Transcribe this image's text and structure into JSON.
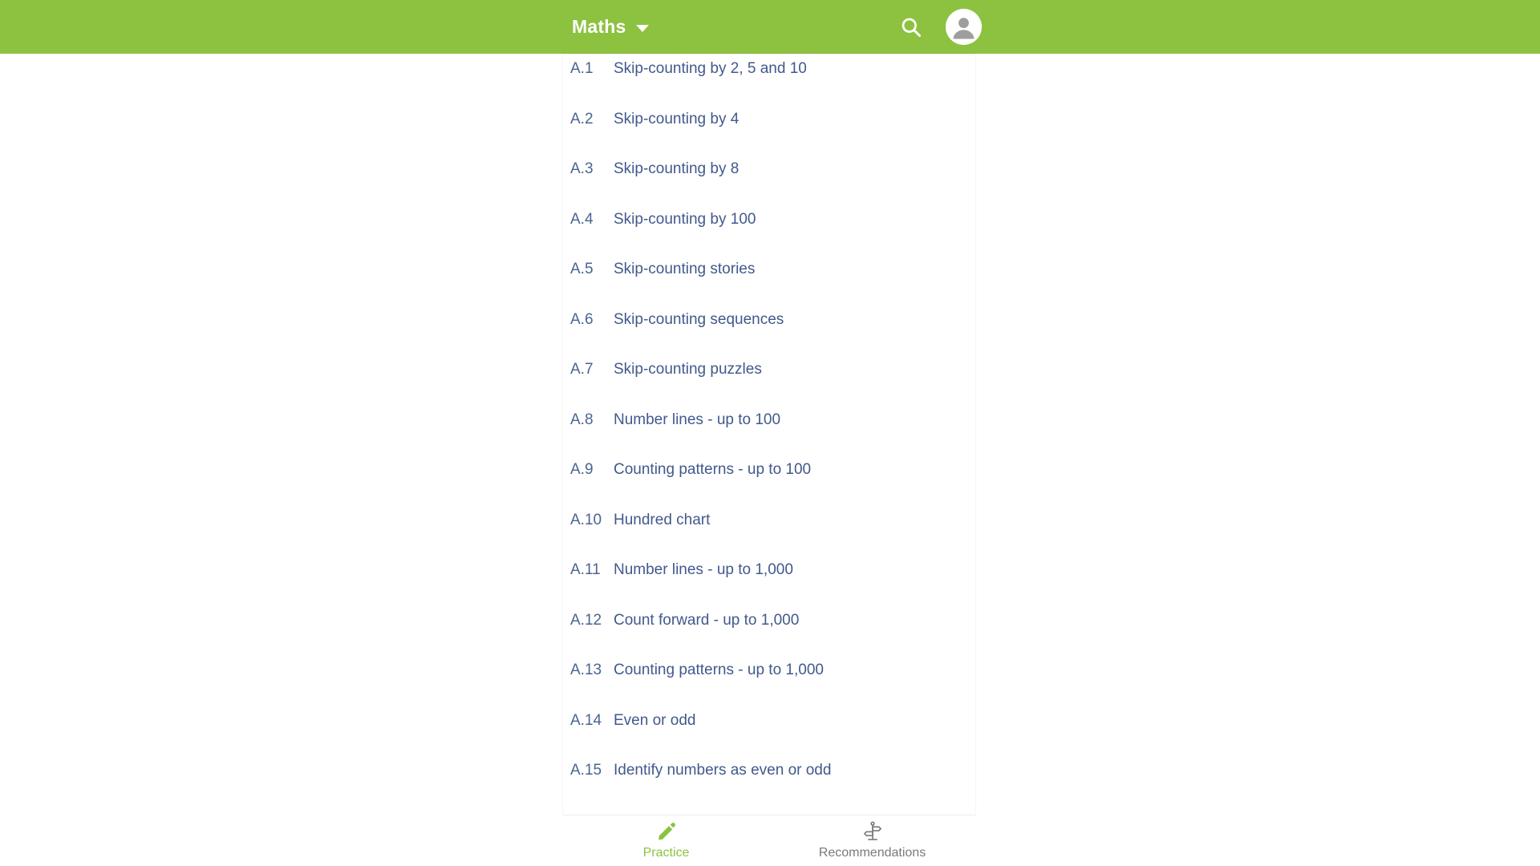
{
  "header": {
    "subject": "Maths",
    "caret_icon": "chevron-down-icon",
    "search_icon": "search-icon",
    "avatar_icon": "account-circle-icon",
    "background_color": "#8cc23f"
  },
  "skills": {
    "text_color": "#41598c",
    "items": [
      {
        "code": "A.1",
        "title": "Skip-counting by 2, 5 and 10"
      },
      {
        "code": "A.2",
        "title": "Skip-counting by 4"
      },
      {
        "code": "A.3",
        "title": "Skip-counting by 8"
      },
      {
        "code": "A.4",
        "title": "Skip-counting by 100"
      },
      {
        "code": "A.5",
        "title": "Skip-counting stories"
      },
      {
        "code": "A.6",
        "title": "Skip-counting sequences"
      },
      {
        "code": "A.7",
        "title": "Skip-counting puzzles"
      },
      {
        "code": "A.8",
        "title": "Number lines - up to 100"
      },
      {
        "code": "A.9",
        "title": "Counting patterns - up to 100"
      },
      {
        "code": "A.10",
        "title": "Hundred chart"
      },
      {
        "code": "A.11",
        "title": "Number lines - up to 1,000"
      },
      {
        "code": "A.12",
        "title": "Count forward - up to 1,000"
      },
      {
        "code": "A.13",
        "title": "Counting patterns - up to 1,000"
      },
      {
        "code": "A.14",
        "title": "Even or odd"
      },
      {
        "code": "A.15",
        "title": "Identify numbers as even or odd"
      }
    ]
  },
  "bottom_nav": {
    "active_color": "#8cc23f",
    "inactive_color": "#7a7a7a",
    "items": [
      {
        "label": "Practice",
        "icon": "pencil-icon",
        "active": true
      },
      {
        "label": "Recommendations",
        "icon": "signpost-icon",
        "active": false
      }
    ]
  }
}
